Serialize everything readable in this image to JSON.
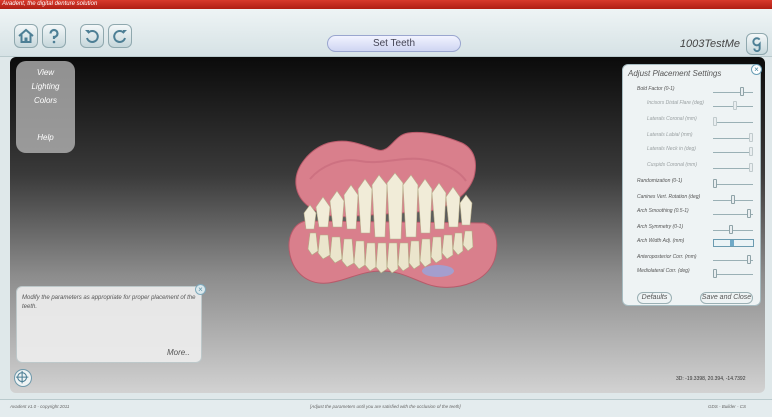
{
  "window": {
    "title": "Avadent, the digital denture solution"
  },
  "toolbar": {
    "title": "Set Teeth",
    "case_name": "1003TestMe",
    "icons": [
      "home-icon",
      "help-icon",
      "undo-icon",
      "redo-icon",
      "logo-icon"
    ]
  },
  "left_menu": {
    "items": [
      "View",
      "Lighting",
      "Colors",
      "Help"
    ]
  },
  "panel": {
    "title": "Adjust Placement Settings",
    "close": "×",
    "rows": [
      {
        "label": "Bold Factor (0-1)",
        "sub": false,
        "level": 0.75
      },
      {
        "label": "Incisors Distal Flare (deg)",
        "sub": true,
        "level": 0.55
      },
      {
        "label": "Laterals Coronal (mm)",
        "sub": true,
        "level": 0.0
      },
      {
        "label": "Laterals Labial (mm)",
        "sub": true,
        "level": 1.0
      },
      {
        "label": "Laterals Neck in (deg)",
        "sub": true,
        "level": 1.0
      },
      {
        "label": "Cuspids Coronal (mm)",
        "sub": true,
        "level": 1.0
      },
      {
        "label": "Randomization (0-1)",
        "sub": false,
        "level": 0.0
      },
      {
        "label": "Canines Vert. Rotation (deg)",
        "sub": false,
        "level": 0.5
      },
      {
        "label": "Arch Smoothing (0.5-1)",
        "sub": false,
        "level": 0.95
      },
      {
        "label": "Arch Symmetry (0-1)",
        "sub": false,
        "level": 0.45
      },
      {
        "label": "Arch Width Adj. (mm)",
        "sub": false,
        "level": 0.45,
        "active": true
      },
      {
        "label": "Anteroposterior Corr. (mm)",
        "sub": false,
        "level": 0.95
      },
      {
        "label": "Mediolateral Corr. (deg)",
        "sub": false,
        "level": 0.0
      }
    ],
    "defaults_label": "Defaults",
    "save_close_label": "Save and Close"
  },
  "hint": {
    "text": "Modify the parameters as appropriate for proper placement of the teeth.",
    "more": "More..",
    "close": "×"
  },
  "coords": "3D: -19.3398, 20.394, -14.7392",
  "status": {
    "left": "Avadent v1.0 - copyright 2011",
    "center": "[Adjust the parameters until you are satisfied with the occlusion of the teeth]",
    "right": "GDS - Builder - CS"
  },
  "colors": {
    "gum": "#d97f8c",
    "teeth": "#f1ecd8",
    "accent": "#6fa9c7",
    "titlebar": "#c82a1f"
  }
}
